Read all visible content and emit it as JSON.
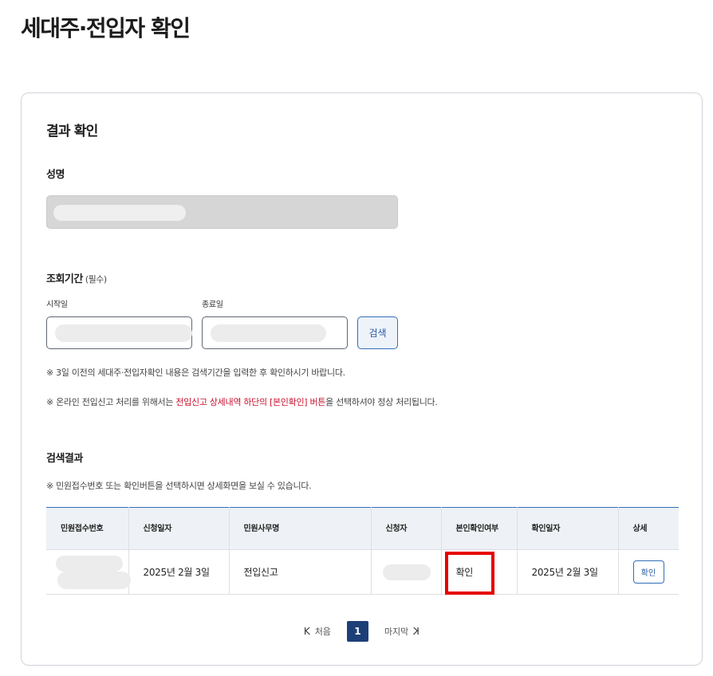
{
  "page": {
    "title": "세대주·전입자 확인"
  },
  "card": {
    "title": "결과 확인"
  },
  "name": {
    "label": "성명"
  },
  "period": {
    "label": "조회기간",
    "required": "(필수)",
    "start_label": "시작일",
    "end_label": "종료일",
    "search_button": "검색"
  },
  "notes": {
    "note1": "※ 3일 이전의 세대주·전입자확인 내용은 검색기간을 입력한 후 확인하시기 바랍니다.",
    "note2_prefix": "※ 온라인 전입신고 처리를 위해서는 ",
    "note2_highlight": "전입신고 상세내역 하단의 [본인확인] 버튼",
    "note2_suffix": "을 선택하셔야 정상 처리됩니다."
  },
  "results": {
    "label": "검색결과",
    "note": "※ 민원접수번호 또는 확인버튼을 선택하시면 상세화면을 보실 수 있습니다.",
    "columns": [
      "민원접수번호",
      "신청일자",
      "민원사무명",
      "신청자",
      "본인확인여부",
      "확인일자",
      "상세"
    ],
    "rows": [
      {
        "apply_date": "2025년 2월 3일",
        "service": "전입신고",
        "verified": "확인",
        "verify_date": "2025년 2월 3일",
        "detail_button": "확인"
      }
    ]
  },
  "pager": {
    "first": "처음",
    "current": "1",
    "last": "마지막",
    "first_arrow": "K",
    "last_arrow": "K"
  },
  "colors": {
    "accent": "#2f6fb8",
    "highlight": "#e60000",
    "pager_active": "#1d3f77",
    "alert_text": "#c8102e"
  }
}
